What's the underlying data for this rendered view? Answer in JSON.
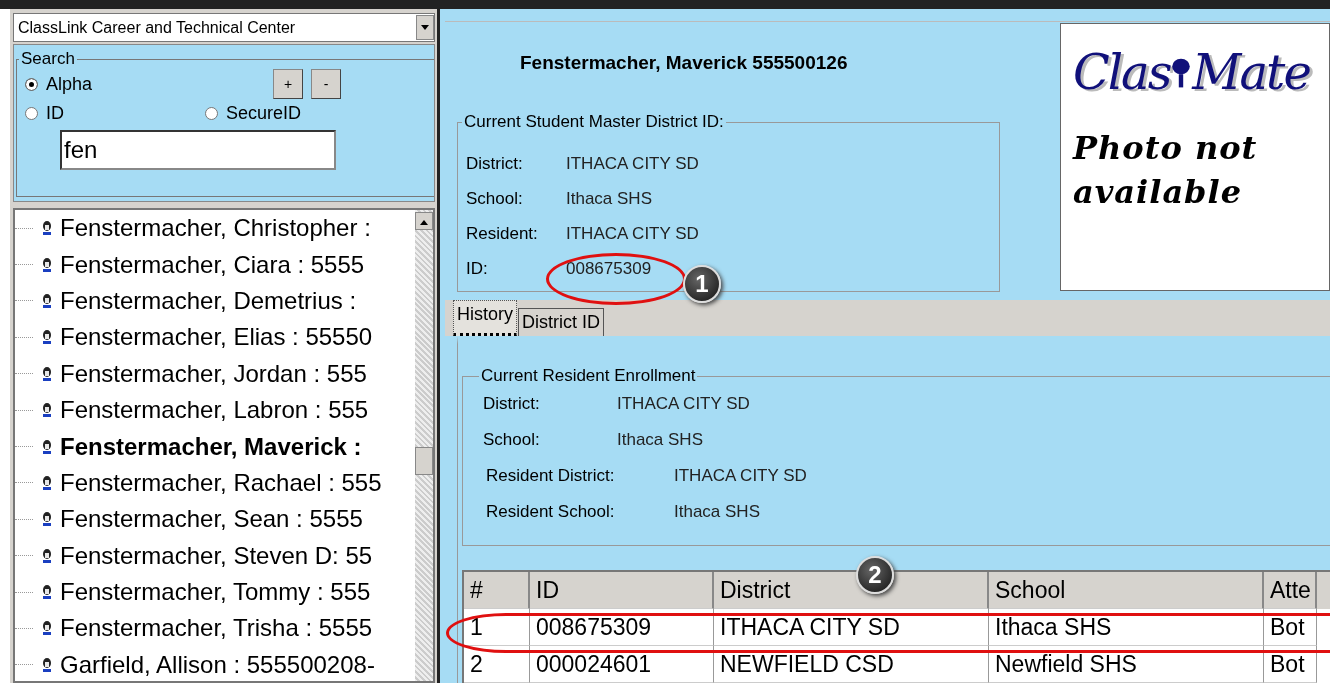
{
  "school_select": {
    "value": "ClassLink Career and Technical Center"
  },
  "search": {
    "title": "Search",
    "options": [
      {
        "label": "Alpha",
        "selected": true
      },
      {
        "label": "ID",
        "selected": false
      },
      {
        "label": "SecureID",
        "selected": false
      }
    ],
    "buttons": [
      "+",
      "-"
    ],
    "value": "fen"
  },
  "students": [
    {
      "label": "Fenstermacher, Christopher :",
      "selected": false
    },
    {
      "label": "Fenstermacher, Ciara  : 5555",
      "selected": false
    },
    {
      "label": "Fenstermacher, Demetrius  :",
      "selected": false
    },
    {
      "label": "Fenstermacher, Elias : 55550",
      "selected": false
    },
    {
      "label": "Fenstermacher, Jordan : 555",
      "selected": false
    },
    {
      "label": "Fenstermacher, Labron : 555",
      "selected": false
    },
    {
      "label": "Fenstermacher, Maverick :",
      "selected": true
    },
    {
      "label": "Fenstermacher, Rachael : 555",
      "selected": false
    },
    {
      "label": "Fenstermacher, Sean  : 5555",
      "selected": false
    },
    {
      "label": "Fenstermacher, Steven D: 55",
      "selected": false
    },
    {
      "label": "Fenstermacher, Tommy : 555",
      "selected": false
    },
    {
      "label": "Fenstermacher, Trisha : 5555",
      "selected": false
    },
    {
      "label": "Garfield, Allison  : 555500208-",
      "selected": false
    }
  ],
  "student_header": "Fenstermacher, Maverick  555500126",
  "master_id": {
    "title": "Current Student Master District ID:",
    "fields": [
      {
        "label": "District:",
        "value": "ITHACA CITY SD"
      },
      {
        "label": "School:",
        "value": "Ithaca SHS"
      },
      {
        "label": "Resident:",
        "value": "ITHACA CITY SD"
      },
      {
        "label": "ID:",
        "value": "008675309"
      }
    ]
  },
  "photo": {
    "logo_left": "Clas",
    "logo_right": "Mate",
    "message": "Photo not available"
  },
  "tabs": [
    {
      "label": "History",
      "selected": true
    },
    {
      "label": "District ID",
      "selected": false
    }
  ],
  "enrollment": {
    "title": "Current Resident Enrollment",
    "fields": [
      {
        "label": "District:",
        "value": "ITHACA CITY SD"
      },
      {
        "label": "School:",
        "value": "Ithaca SHS"
      },
      {
        "label": "Resident District:",
        "value": "ITHACA CITY SD"
      },
      {
        "label": "Resident School:",
        "value": "Ithaca SHS"
      }
    ]
  },
  "table": {
    "columns": [
      "#",
      "ID",
      "District",
      "School",
      "Atte"
    ],
    "rows": [
      [
        "1",
        "008675309",
        "ITHACA CITY SD",
        "Ithaca SHS",
        "Bot"
      ],
      [
        "2",
        "000024601",
        "NEWFIELD CSD",
        "Newfield SHS",
        "Bot"
      ]
    ]
  },
  "callouts": [
    {
      "number": "1"
    },
    {
      "number": "2"
    }
  ]
}
